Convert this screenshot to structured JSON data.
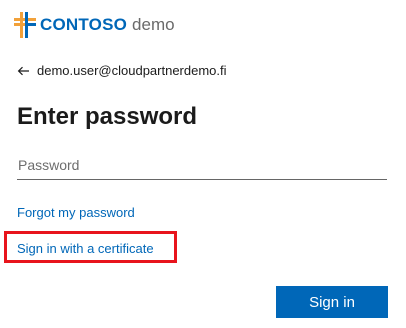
{
  "branding": {
    "brand_name": "CONTOSO",
    "brand_suffix": "demo",
    "logo_icon": "contoso-logo-icon",
    "colors": {
      "logo_orange": "#f2a13a",
      "logo_blue": "#0067b8",
      "link": "#0067b8",
      "button": "#0067b8",
      "highlight": "#e8141c"
    }
  },
  "identity": {
    "back_icon": "back-arrow-icon",
    "email": "demo.user@cloudpartnerdemo.fi"
  },
  "form": {
    "title": "Enter password",
    "password_placeholder": "Password",
    "forgot_password_link": "Forgot my password",
    "certificate_link": "Sign in with a certificate",
    "sign_in_button": "Sign in"
  }
}
